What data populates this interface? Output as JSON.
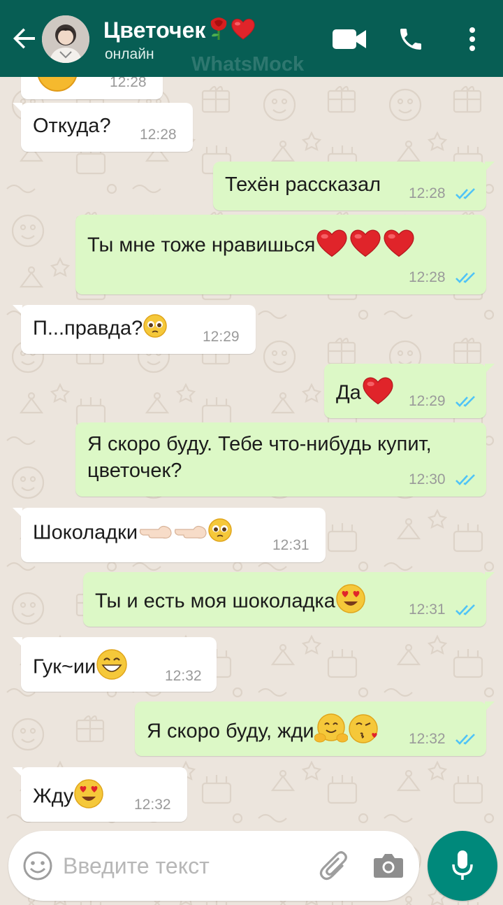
{
  "header": {
    "contact_name": "Цветочек",
    "name_emojis": [
      "rose-emoji",
      "red-heart-emoji"
    ],
    "status": "онлайн",
    "watermark": "WhatsMock",
    "icons": [
      "back-arrow-icon",
      "video-call-icon",
      "phone-call-icon",
      "more-vert-icon"
    ],
    "color": "#075E54"
  },
  "messages": [
    {
      "dir": "in",
      "text": "",
      "emojis": [
        "grinning-face-emoji"
      ],
      "time": "12:28"
    },
    {
      "dir": "in",
      "text": "Откуда?",
      "time": "12:28"
    },
    {
      "dir": "out",
      "text": "Техён рассказал",
      "time": "12:28",
      "read": true
    },
    {
      "dir": "out",
      "text": "Ты мне тоже нравишься",
      "emojis": [
        "red-heart-emoji",
        "red-heart-emoji",
        "red-heart-emoji"
      ],
      "time": "12:28",
      "read": true
    },
    {
      "dir": "in",
      "text": "П...правда?",
      "emojis": [
        "pleading-face-emoji"
      ],
      "time": "12:29"
    },
    {
      "dir": "out",
      "text": "Да",
      "emojis": [
        "red-heart-emoji"
      ],
      "time": "12:29",
      "read": true
    },
    {
      "dir": "out",
      "text": "Я скоро буду. Тебе что-нибудь купит, цветочек?",
      "time": "12:30",
      "read": true
    },
    {
      "dir": "in",
      "text": "Шоколадки",
      "emojis": [
        "pointing-left-hand-emoji",
        "pointing-left-hand-emoji",
        "pleading-face-emoji"
      ],
      "time": "12:31"
    },
    {
      "dir": "out",
      "text": "Ты и есть моя шоколадка",
      "emojis": [
        "heart-eyes-emoji"
      ],
      "time": "12:31",
      "read": true
    },
    {
      "dir": "in",
      "text": "Гук~ии",
      "emojis": [
        "grinning-face-emoji"
      ],
      "time": "12:32"
    },
    {
      "dir": "out",
      "text": "Я скоро буду, жди",
      "emojis": [
        "hugging-face-emoji",
        "face-blowing-kiss-emoji"
      ],
      "time": "12:32",
      "read": true
    },
    {
      "dir": "in",
      "text": "Жду",
      "emojis": [
        "heart-eyes-emoji"
      ],
      "time": "12:32"
    }
  ],
  "input": {
    "placeholder": "Введите текст",
    "icons": [
      "emoji-icon",
      "attach-icon",
      "camera-icon",
      "mic-icon"
    ]
  },
  "colors": {
    "incoming": "#FFFFFF",
    "outgoing": "#DCF8C6",
    "read_ticks": "#4FC3F7",
    "background": "#ECE5DD",
    "send_button": "#00897B"
  }
}
